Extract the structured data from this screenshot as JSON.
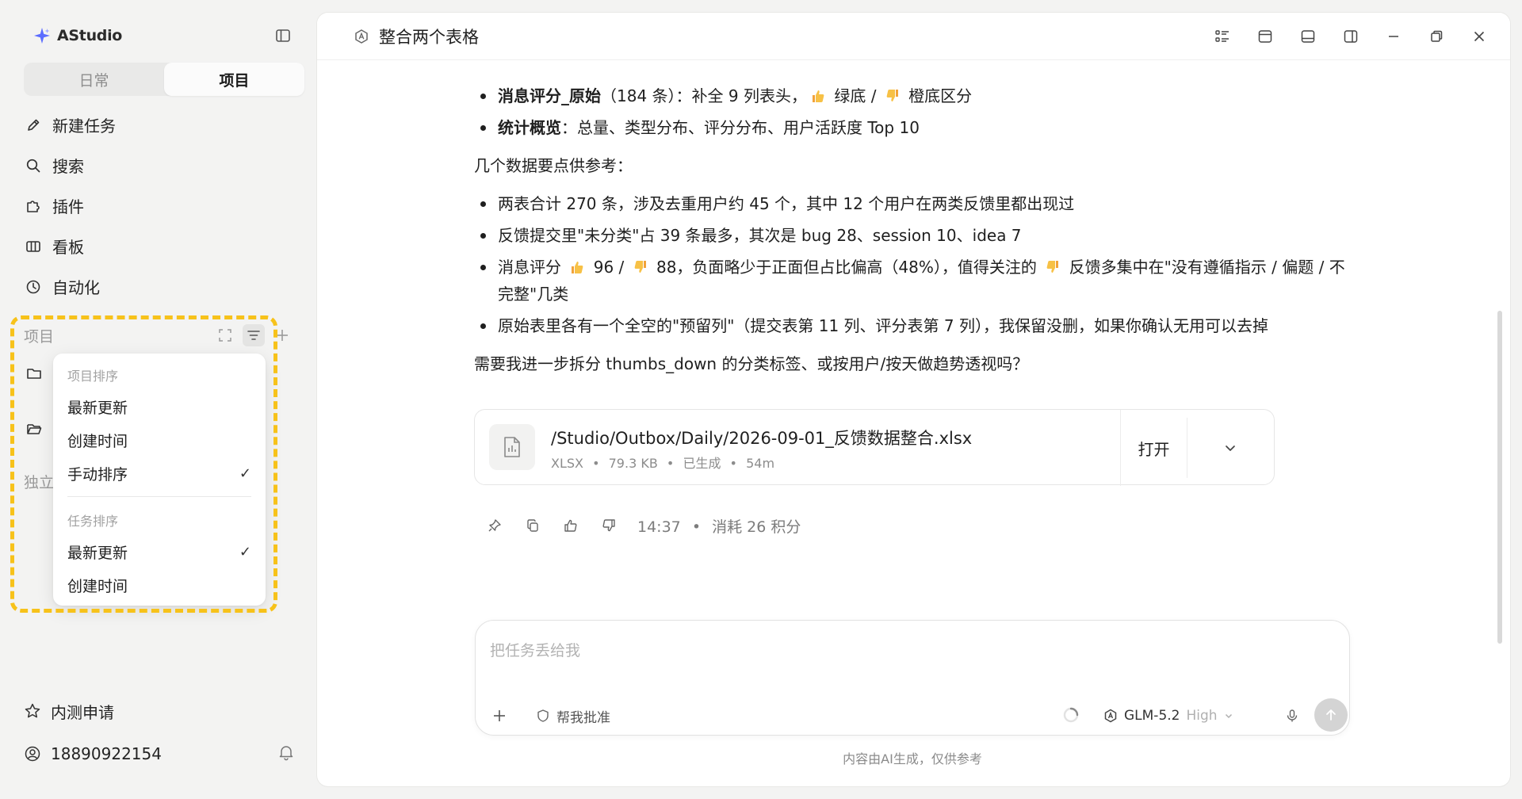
{
  "app": {
    "name": "AStudio"
  },
  "sidebar": {
    "tabs": [
      {
        "label": "日常",
        "active": false
      },
      {
        "label": "项目",
        "active": true
      }
    ],
    "nav": [
      {
        "label": "新建任务",
        "icon": "pencil-icon"
      },
      {
        "label": "搜索",
        "icon": "search-icon"
      },
      {
        "label": "插件",
        "icon": "plugin-icon"
      },
      {
        "label": "看板",
        "icon": "board-icon"
      },
      {
        "label": "自动化",
        "icon": "clock-icon"
      }
    ],
    "projects_title": "项目",
    "independent_label": "独立",
    "bottom": {
      "beta_label": "内测申请",
      "user_label": "18890922154"
    }
  },
  "sort_menu": {
    "project_section": "项目排序",
    "project_items": [
      {
        "label": "最新更新",
        "checked": false
      },
      {
        "label": "创建时间",
        "checked": false
      },
      {
        "label": "手动排序",
        "checked": true
      }
    ],
    "task_section": "任务排序",
    "task_items": [
      {
        "label": "最新更新",
        "checked": true
      },
      {
        "label": "创建时间",
        "checked": false
      }
    ],
    "check_mark": "✓"
  },
  "header": {
    "task_title": "整合两个表格"
  },
  "message": {
    "bullets_top": [
      {
        "bold": "消息评分_原始",
        "text_a": "（184 条）：补全 9 列表头，",
        "up": "👍",
        "text_b": " 绿底 / ",
        "down": "👎",
        "text_c": " 橙底区分"
      },
      {
        "bold": "统计概览",
        "text_a": "：总量、类型分布、评分分布、用户活跃度 Top 10"
      }
    ],
    "intro": "几个数据要点供参考：",
    "points": [
      "两表合计 270 条，涉及去重用户约 45 个，其中 12 个用户在两类反馈里都出现过",
      "反馈提交里\"未分类\"占 39 条最多，其次是 bug 28、session 10、idea 7"
    ],
    "point3": {
      "a": "消息评分 ",
      "up": "👍",
      "b": " 96 / ",
      "down": "👎",
      "c": " 88，负面略少于正面但占比偏高（48%），值得关注的 ",
      "down2": "👎",
      "d": " 反馈多集中在\"没有遵循指示 / 偏题 / 不完整\"几类"
    },
    "point4": "原始表里各有一个全空的\"预留列\"（提交表第 11 列、评分表第 7 列），我保留没删，如果你确认无用可以去掉",
    "question": "需要我进一步拆分 thumbs_down 的分类标签、或按用户/按天做趋势透视吗？"
  },
  "file": {
    "path": "/Studio/Outbox/Daily/2026-09-01_反馈数据整合.xlsx",
    "type": "XLSX",
    "size": "79.3 KB",
    "status": "已生成",
    "age": "54m",
    "open_label": "打开"
  },
  "meta": {
    "time": "14:37",
    "cost": "消耗 26 积分",
    "sep": "•"
  },
  "composer": {
    "placeholder": "把任务丢给我",
    "approve_label": "帮我批准",
    "model": "GLM-5.2",
    "level": "High"
  },
  "disclaimer": "内容由AI生成，仅供参考",
  "colors": {
    "highlight": "#f7c21a",
    "brand": "#5b6cff"
  }
}
